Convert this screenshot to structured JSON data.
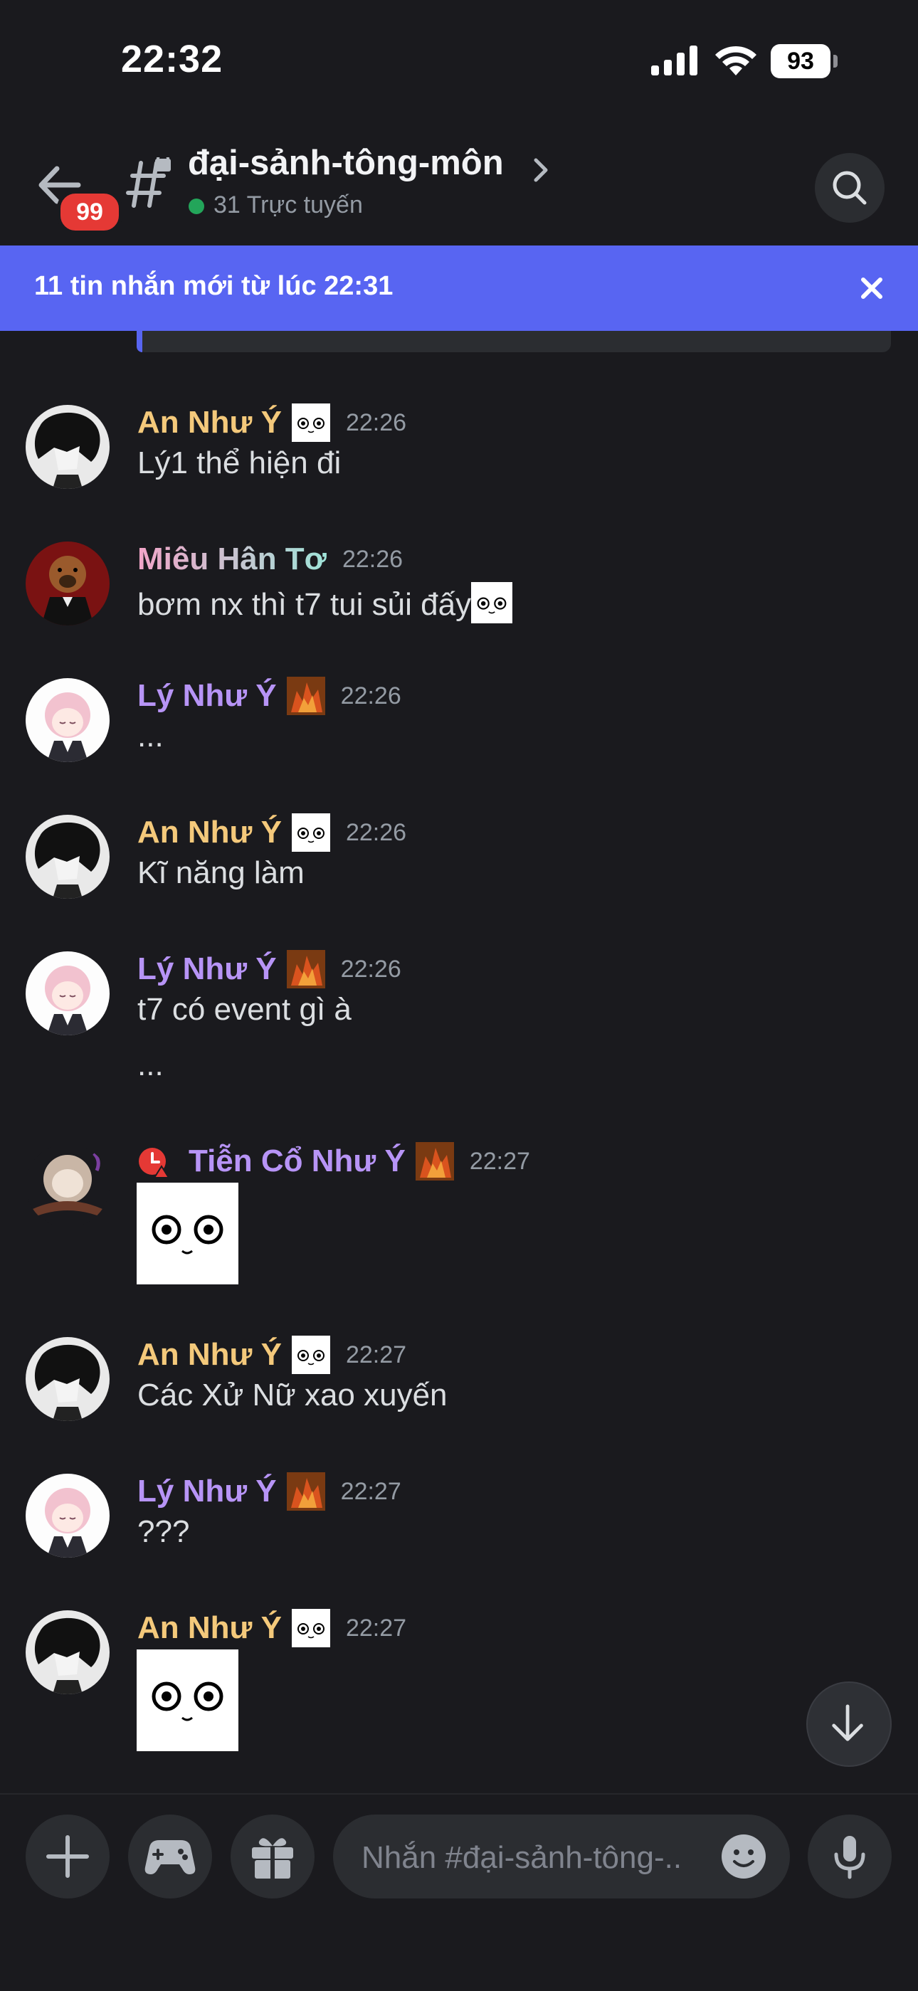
{
  "status_bar": {
    "time": "22:32",
    "battery": "93"
  },
  "header": {
    "unread_count": "99",
    "channel_name": "đại-sảnh-tông-môn",
    "online": "31 Trực tuyến"
  },
  "new_messages_bar": {
    "text": "11 tin nhắn mới từ lúc 22:31"
  },
  "messages": [
    {
      "author": "An Như Ý",
      "time": "22:26",
      "text": "Lý1 thể hiện đi"
    },
    {
      "author": "Miêu Hân Tơ",
      "time": "22:26",
      "text": "bơm  nx thì t7 tui sủi đấy"
    },
    {
      "author": "Lý Như Ý",
      "time": "22:26",
      "text": "..."
    },
    {
      "author": "An Như Ý",
      "time": "22:26",
      "text": "Kĩ năng làm"
    },
    {
      "author": "Lý Như Ý",
      "time": "22:26",
      "text": "t7  có event gì à",
      "text2": "..."
    },
    {
      "author": "Tiễn Cổ Như Ý",
      "time": "22:27"
    },
    {
      "author": "An Như Ý",
      "time": "22:27",
      "text": "Các Xử Nữ xao xuyến"
    },
    {
      "author": "Lý Như Ý",
      "time": "22:27",
      "text": "???"
    },
    {
      "author": "An Như Ý",
      "time": "22:27"
    }
  ],
  "composer": {
    "placeholder": "Nhắn #đại-sảnh-tông-.."
  },
  "colors": {
    "accent": "#5865f2",
    "online": "#23a55a",
    "badge": "#e53935"
  },
  "icons": [
    "back-arrow-icon",
    "channel-lock-icon",
    "chevron-right-icon",
    "search-icon",
    "close-icon",
    "plus-icon",
    "gamepad-icon",
    "gift-icon",
    "emoji-icon",
    "mic-icon",
    "arrow-down-icon",
    "do-not-disturb-icon"
  ]
}
